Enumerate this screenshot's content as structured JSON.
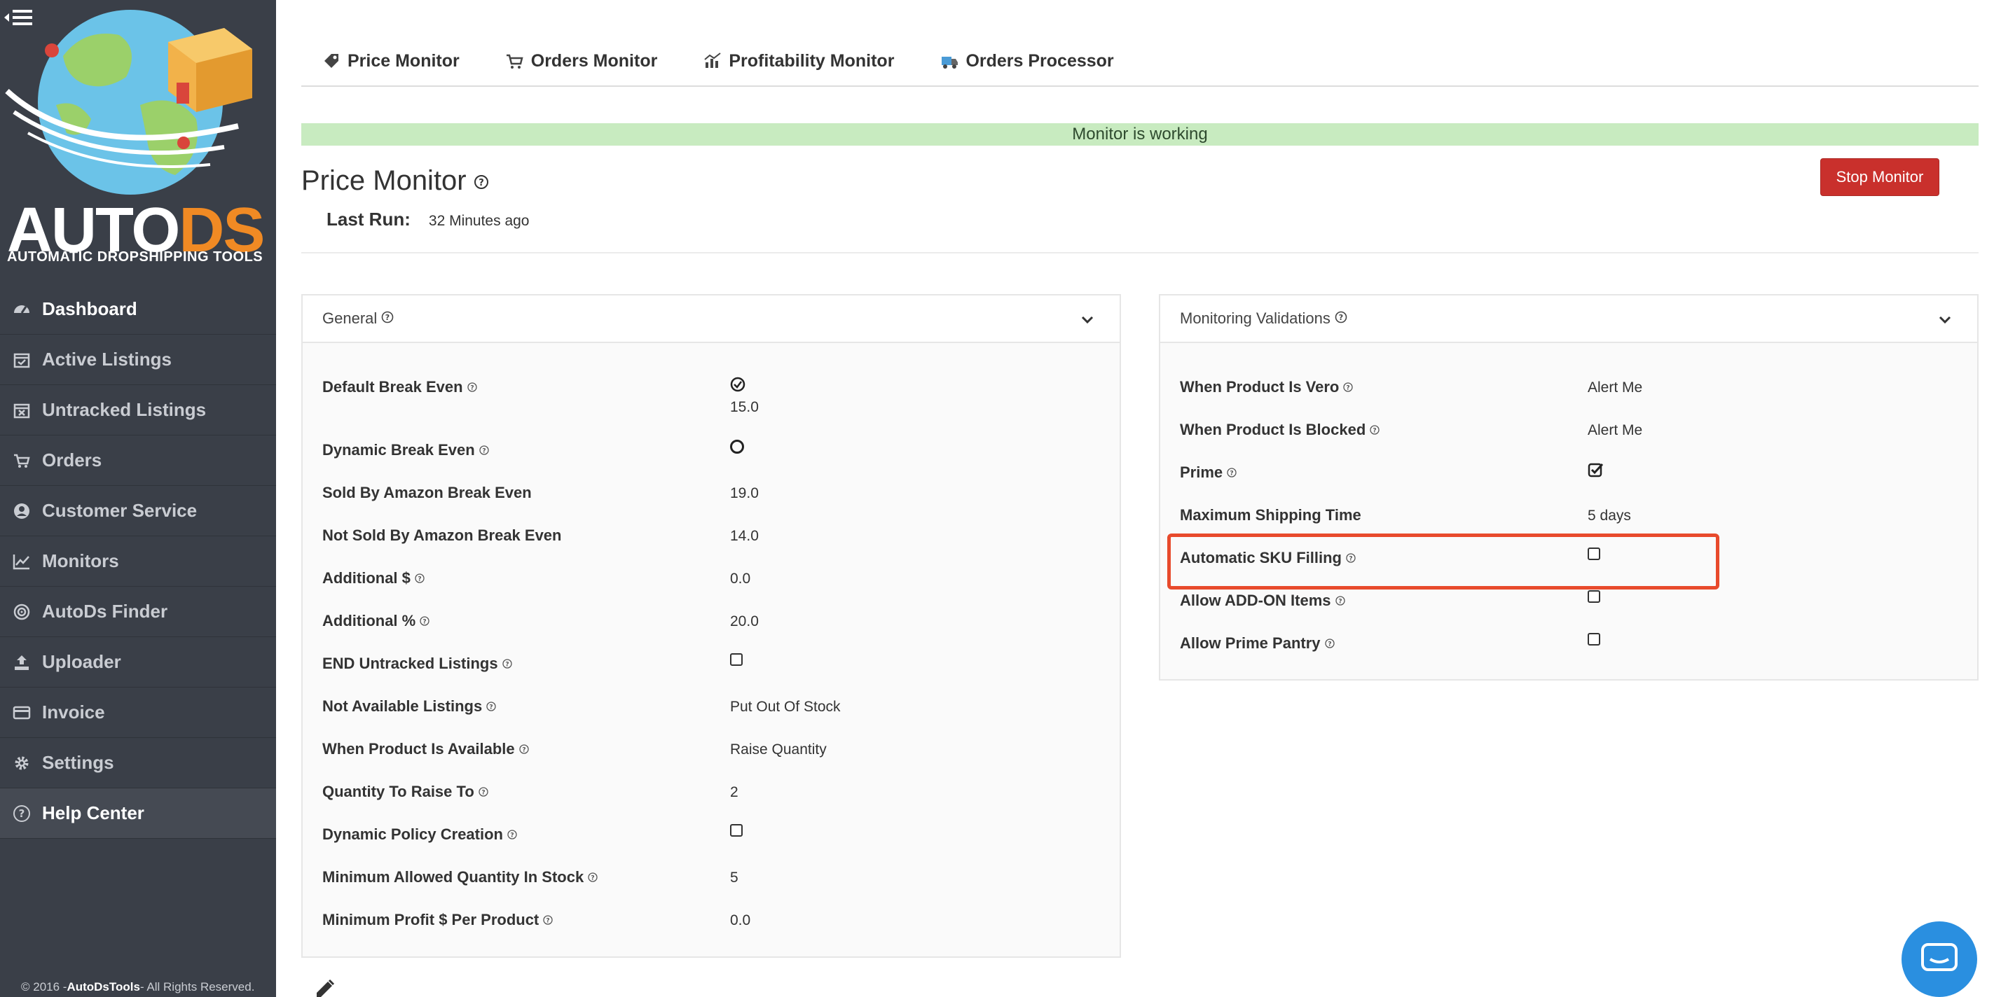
{
  "sidebar": {
    "logo_main": "AUTO",
    "logo_accent": "DS",
    "logo_tagline": "AUTOMATIC DROPSHIPPING TOOLS",
    "items": [
      {
        "label": "Dashboard",
        "icon": "dashboard-icon"
      },
      {
        "label": "Active Listings",
        "icon": "calendar-check-icon"
      },
      {
        "label": "Untracked Listings",
        "icon": "calendar-x-icon"
      },
      {
        "label": "Orders",
        "icon": "cart-icon"
      },
      {
        "label": "Customer Service",
        "icon": "user-circle-icon"
      },
      {
        "label": "Monitors",
        "icon": "chart-line-icon"
      },
      {
        "label": "AutoDs Finder",
        "icon": "target-icon"
      },
      {
        "label": "Uploader",
        "icon": "upload-icon"
      },
      {
        "label": "Invoice",
        "icon": "credit-card-icon"
      },
      {
        "label": "Settings",
        "icon": "gear-icon"
      },
      {
        "label": "Help Center",
        "icon": "question-circle-icon"
      }
    ],
    "footer_prefix": "© 2016 -",
    "footer_brand": "AutoDsTools",
    "footer_suffix": "- All Rights Reserved."
  },
  "tabs": [
    {
      "label": "Price Monitor",
      "icon": "tag-icon"
    },
    {
      "label": "Orders Monitor",
      "icon": "cart-icon"
    },
    {
      "label": "Profitability Monitor",
      "icon": "chart-bar-icon"
    },
    {
      "label": "Orders Processor",
      "icon": "truck-icon"
    }
  ],
  "status": {
    "text": "Monitor is working",
    "color": "#c8ebc0"
  },
  "page": {
    "title": "Price Monitor",
    "last_run_label": "Last Run:",
    "last_run_value": "32 Minutes ago",
    "stop_button": "Stop Monitor"
  },
  "general": {
    "title": "General",
    "rows": [
      {
        "label": "Default Break Even",
        "value": "15.0"
      },
      {
        "label": "Dynamic Break Even"
      },
      {
        "label": "Sold By Amazon Break Even",
        "value": "19.0"
      },
      {
        "label": "Not Sold By Amazon Break Even",
        "value": "14.0"
      },
      {
        "label": "Additional $",
        "value": "0.0"
      },
      {
        "label": "Additional %",
        "value": "20.0"
      },
      {
        "label": "END Untracked Listings"
      },
      {
        "label": "Not Available Listings",
        "value": "Put Out Of Stock"
      },
      {
        "label": "When Product Is Available",
        "value": "Raise Quantity"
      },
      {
        "label": "Quantity To Raise To",
        "value": "2"
      },
      {
        "label": "Dynamic Policy Creation"
      },
      {
        "label": "Minimum Allowed Quantity In Stock",
        "value": "5"
      },
      {
        "label": "Minimum Profit $ Per Product",
        "value": "0.0"
      }
    ]
  },
  "validations": {
    "title": "Monitoring Validations",
    "rows": [
      {
        "label": "When Product Is Vero",
        "value": "Alert Me"
      },
      {
        "label": "When Product Is Blocked",
        "value": "Alert Me"
      },
      {
        "label": "Prime"
      },
      {
        "label": "Maximum Shipping Time",
        "value": "5 days"
      },
      {
        "label": "Automatic SKU Filling"
      },
      {
        "label": "Allow ADD-ON Items"
      },
      {
        "label": "Allow Prime Pantry"
      }
    ]
  },
  "colors": {
    "sidebar": "#3a3f48",
    "danger": "#c9302c",
    "highlight": "#e84a2c",
    "accent": "#f08a24",
    "chat": "#2a8fe0"
  }
}
